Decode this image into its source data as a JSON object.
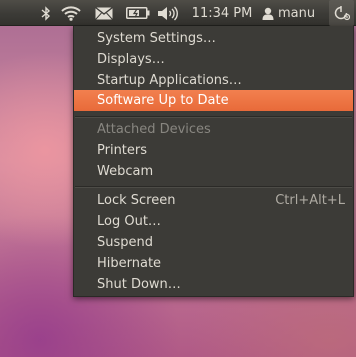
{
  "panel": {
    "clock": "11:34 PM",
    "user": "manu",
    "icons": [
      "bluetooth-icon",
      "wifi-icon",
      "mail-icon",
      "battery-icon",
      "volume-icon",
      "user-icon",
      "power-icon"
    ]
  },
  "menu": {
    "items": [
      {
        "label": "System Settings…"
      },
      {
        "label": "Displays…"
      },
      {
        "label": "Startup Applications…"
      },
      {
        "label": "Software Up to Date",
        "highlighted": true
      }
    ],
    "devices_header": "Attached Devices",
    "devices": [
      {
        "label": "Printers"
      },
      {
        "label": "Webcam"
      }
    ],
    "session": [
      {
        "label": "Lock Screen",
        "accel": "Ctrl+Alt+L"
      },
      {
        "label": "Log Out…"
      },
      {
        "label": "Suspend"
      },
      {
        "label": "Hibernate"
      },
      {
        "label": "Shut Down…"
      }
    ]
  },
  "colors": {
    "panel_bg": "#3c3b37",
    "menu_bg": "#3c3b37",
    "highlight": "#f07746",
    "text": "#dfdbd2"
  }
}
